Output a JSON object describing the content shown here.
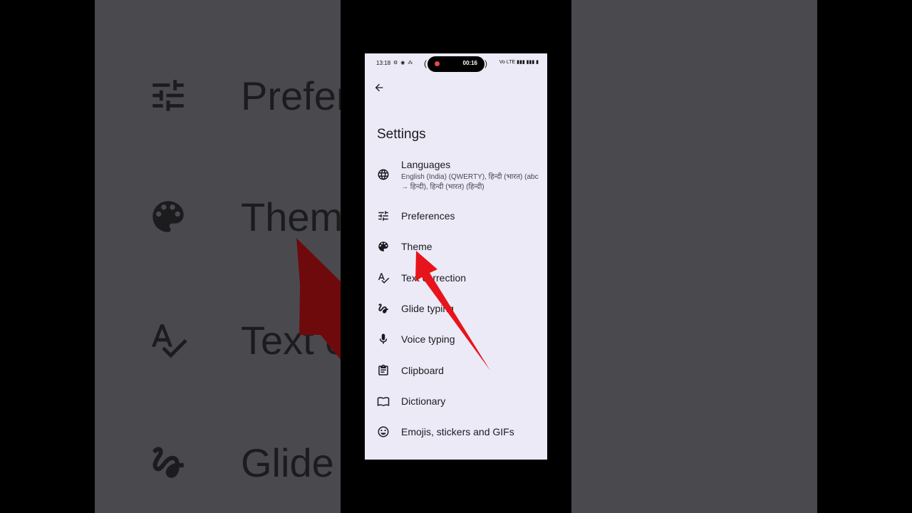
{
  "status_bar": {
    "time": "13:18",
    "left_icons": "⚙ ◉ ⁂",
    "recording_time": "00:16",
    "right_icons": "Vo LTE ▮▮▮ ▮▮▮ ▮"
  },
  "header": {
    "title": "Settings"
  },
  "settings": {
    "items": [
      {
        "label": "Languages",
        "subtitle": "English (India) (QWERTY), हिन्दी (भारत) (abc → हिन्दी), हिन्दी (भारत) (हिन्दी)",
        "icon": "globe-icon"
      },
      {
        "label": "Preferences",
        "icon": "sliders-icon"
      },
      {
        "label": "Theme",
        "icon": "palette-icon"
      },
      {
        "label": "Text correction",
        "icon": "spellcheck-icon"
      },
      {
        "label": "Glide typing",
        "icon": "gesture-icon"
      },
      {
        "label": "Voice typing",
        "icon": "mic-icon"
      },
      {
        "label": "Clipboard",
        "icon": "clipboard-icon"
      },
      {
        "label": "Dictionary",
        "icon": "book-icon"
      },
      {
        "label": "Emojis, stickers and GIFs",
        "icon": "emoji-icon"
      }
    ]
  },
  "background_blur": {
    "labels": [
      "Prefer",
      "Them",
      "Text c",
      "Glide"
    ]
  },
  "colors": {
    "screen_bg": "#eceaf7",
    "text": "#1b1b1f",
    "annotation_arrow": "#e8141b",
    "recording_dot": "#e24b4b"
  }
}
